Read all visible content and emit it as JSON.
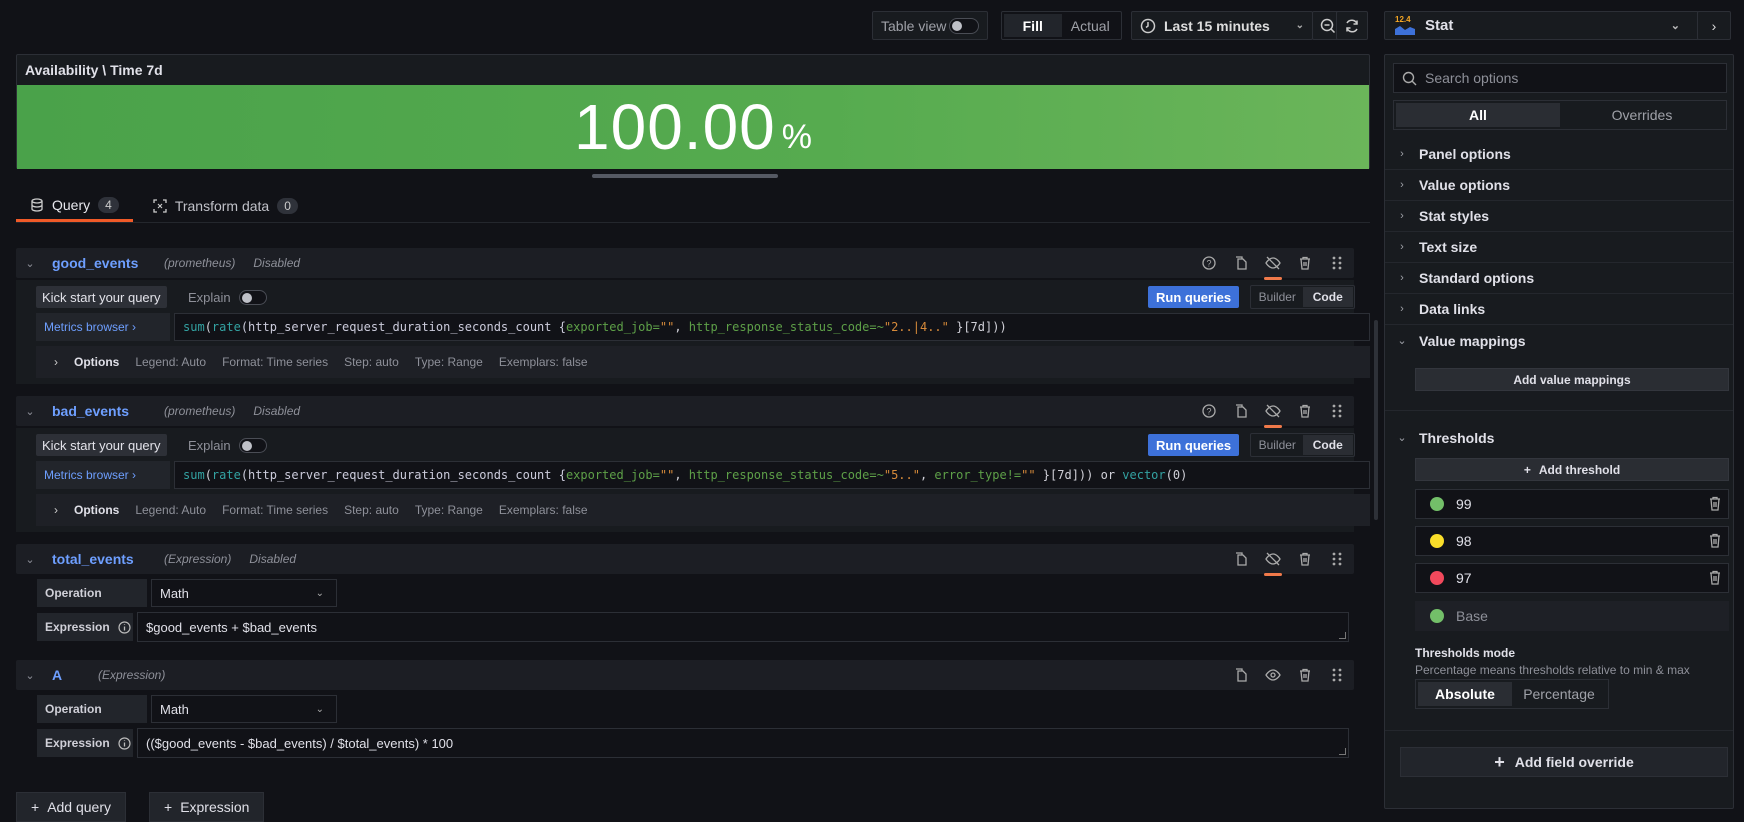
{
  "toolbar": {
    "table_view_label": "Table view",
    "fill_label": "Fill",
    "actual_label": "Actual",
    "time_range": "Last 15 minutes",
    "visualization": "Stat",
    "viz_icon_text": "12.4"
  },
  "panel": {
    "title": "Availability \\ Time 7d",
    "value": "100.00",
    "unit": "%",
    "color": "#56ab4f"
  },
  "tabs": [
    {
      "label": "Query",
      "count": "4"
    },
    {
      "label": "Transform data",
      "count": "0"
    }
  ],
  "queries": [
    {
      "name": "good_events",
      "source": "(prometheus)",
      "status": "Disabled",
      "kick_start": "Kick start your query",
      "explain": "Explain",
      "run": "Run queries",
      "builder": "Builder",
      "code_mode": "Code",
      "metrics_browser": "Metrics browser ›",
      "code_parts": {
        "fn1": "sum",
        "fn2": "rate",
        "metric": "(http_server_request_duration_seconds_count {",
        "l1": "exported_job=",
        "v1": "\"\"",
        "sep": ", ",
        "l2": "http_response_status_code=~",
        "v2": "\"2..|4..\"",
        "end": " }[7d]))"
      },
      "options": {
        "title": "Options",
        "legend": "Legend: Auto",
        "format": "Format: Time series",
        "step": "Step: auto",
        "type": "Type: Range",
        "exemplars": "Exemplars: false"
      }
    },
    {
      "name": "bad_events",
      "source": "(prometheus)",
      "status": "Disabled",
      "kick_start": "Kick start your query",
      "explain": "Explain",
      "run": "Run queries",
      "builder": "Builder",
      "code_mode": "Code",
      "metrics_browser": "Metrics browser ›",
      "code_parts": {
        "fn1": "sum",
        "fn2": "rate",
        "metric": "(http_server_request_duration_seconds_count {",
        "l1": "exported_job=",
        "v1": "\"\"",
        "sep": ", ",
        "l2": "http_response_status_code=~",
        "v2": "\"5..\"",
        "sep2": ", ",
        "l3": "error_type!=",
        "v3": "\"\"",
        "end": " }[7d])) or ",
        "fn3": "vector",
        "end2": "(0)"
      },
      "options": {
        "title": "Options",
        "legend": "Legend: Auto",
        "format": "Format: Time series",
        "step": "Step: auto",
        "type": "Type: Range",
        "exemplars": "Exemplars: false"
      }
    },
    {
      "name": "total_events",
      "source": "(Expression)",
      "status": "Disabled",
      "operation_label": "Operation",
      "operation": "Math",
      "expression_label": "Expression",
      "expression": "$good_events + $bad_events"
    },
    {
      "name": "A",
      "source": "(Expression)",
      "status": "",
      "operation_label": "Operation",
      "operation": "Math",
      "expression_label": "Expression",
      "expression": "(($good_events - $bad_events) / $total_events) * 100"
    }
  ],
  "add_query": "Add query",
  "add_expression": "Expression",
  "options_pane": {
    "search_placeholder": "Search options",
    "tab_all": "All",
    "tab_overrides": "Overrides",
    "sections": [
      "Panel options",
      "Value options",
      "Stat styles",
      "Text size",
      "Standard options",
      "Data links",
      "Value mappings"
    ],
    "add_value_mappings": "Add value mappings",
    "thresholds_title": "Thresholds",
    "add_threshold": "Add threshold",
    "thresholds": [
      {
        "value": "99",
        "color": "#73bf69"
      },
      {
        "value": "98",
        "color": "#fade2a"
      },
      {
        "value": "97",
        "color": "#f2495c"
      },
      {
        "value": "Base",
        "color": "#73bf69"
      }
    ],
    "thresholds_mode_title": "Thresholds mode",
    "thresholds_mode_desc": "Percentage means thresholds relative to min & max",
    "mode_absolute": "Absolute",
    "mode_percentage": "Percentage",
    "add_field_override": "Add field override"
  }
}
